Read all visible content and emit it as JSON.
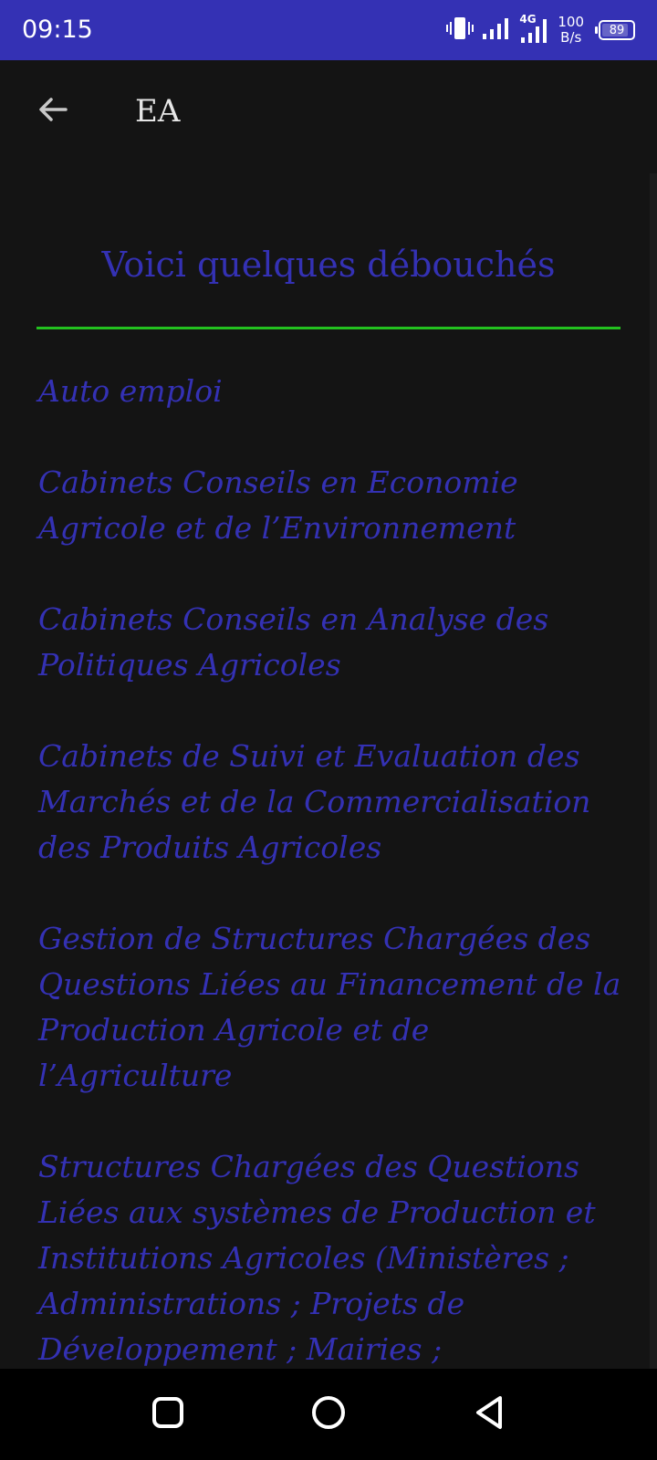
{
  "status_bar": {
    "time": "09:15",
    "network_type": "4G",
    "speed_value": "100",
    "speed_unit": "B/s",
    "battery_level": "89",
    "battery_fraction": 0.89,
    "icons": [
      "vibrate-icon",
      "signal-icon",
      "signal-4g-icon",
      "battery-icon"
    ]
  },
  "app_bar": {
    "title": "EA",
    "back_icon": "arrow-left-icon"
  },
  "content": {
    "heading": "Voici quelques débouchés",
    "items": [
      "Auto emploi",
      "Cabinets Conseils en Economie Agricole et de l’Environnement",
      "Cabinets Conseils en Analyse des Politiques Agricoles",
      "Cabinets de Suivi et Evaluation des Marchés et de la Commercialisation des Produits Agricoles",
      "Gestion de Structures Chargées des Questions Liées au Financement de la Production Agricole et de l’Agriculture",
      "Structures Chargées des Questions Liées aux systèmes de Production et Institutions Agricoles (Ministères ; Administrations ; Projets de Développement ; Mairies ; Entreprises de tous Genres)."
    ]
  },
  "nav_bar": {
    "buttons": [
      "recent-apps-icon",
      "home-icon",
      "back-triangle-icon"
    ]
  },
  "colors": {
    "status_bar": "#3431b4",
    "background": "#141414",
    "heading": "#3431b4",
    "list_text": "#3431b4",
    "divider": "#23c11f",
    "title": "#e6e6e6",
    "nav_bar": "#000000"
  }
}
